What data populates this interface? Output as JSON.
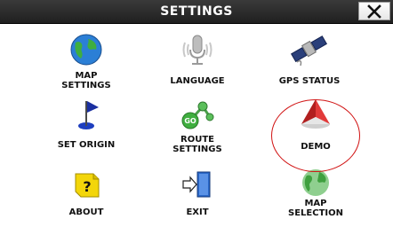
{
  "window": {
    "title": "SETTINGS",
    "close_glyph": "✕"
  },
  "tiles": [
    {
      "label": "MAP\nSETTINGS",
      "icon": "globe-icon"
    },
    {
      "label": "LANGUAGE",
      "icon": "microphone-icon"
    },
    {
      "label": "GPS STATUS",
      "icon": "satellite-icon"
    },
    {
      "label": "SET ORIGIN",
      "icon": "flag-pin-icon"
    },
    {
      "label": "ROUTE\nSETTINGS",
      "icon": "route-nodes-icon"
    },
    {
      "label": "DEMO",
      "icon": "navigation-arrow-icon"
    },
    {
      "label": "ABOUT",
      "icon": "help-box-icon"
    },
    {
      "label": "EXIT",
      "icon": "exit-door-icon"
    },
    {
      "label": "MAP\nSELECTION",
      "icon": "globe-map-icon"
    }
  ],
  "highlight": {
    "target": "DEMO",
    "color": "#d11414"
  },
  "colors": {
    "titlebar": "#2a2a2a",
    "title_text": "#ffffff",
    "label_text": "#111111"
  }
}
